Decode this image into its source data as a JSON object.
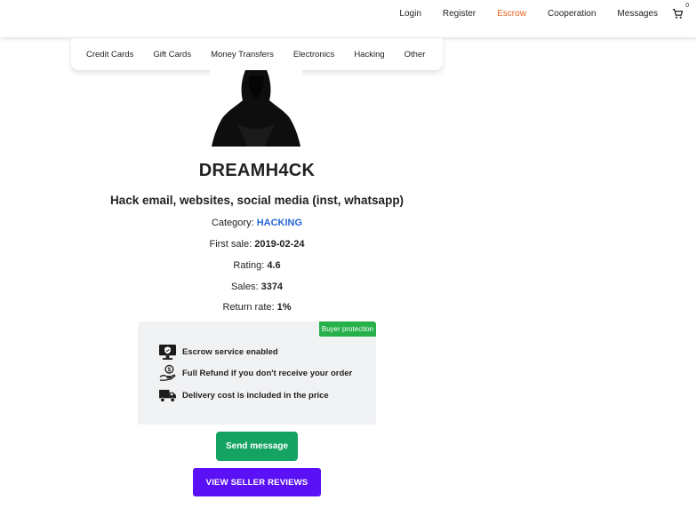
{
  "topnav": {
    "items": [
      {
        "label": "Login",
        "active": false
      },
      {
        "label": "Register",
        "active": false
      },
      {
        "label": "Escrow",
        "active": true
      },
      {
        "label": "Cooperation",
        "active": false
      },
      {
        "label": "Messages",
        "active": false
      }
    ],
    "cart_icon": "shopping-cart-icon",
    "cart_count": "0",
    "active_color": "#e8611a"
  },
  "categories": [
    "Credit Cards",
    "Gift Cards",
    "Money Transfers",
    "Electronics",
    "Hacking",
    "Other"
  ],
  "seller": {
    "avatar_icon": "hooded-figure-avatar",
    "name": "DREAMH4CK"
  },
  "product": {
    "title": "Hack email, websites, social media (inst, whatsapp)",
    "category_label": "Category:",
    "category_value": "HACKING",
    "first_sale_label": "First sale:",
    "first_sale_value": "2019-02-24",
    "rating_label": "Rating:",
    "rating_value": "4.6",
    "sales_label": "Sales:",
    "sales_value": "3374",
    "return_rate_label": "Return rate:",
    "return_rate_value": "1%",
    "link_color": "#2867d6"
  },
  "protection": {
    "badge": "Buyer protection",
    "badge_color": "#25b04a",
    "items": [
      {
        "icon": "shield-monitor-icon",
        "text": "Escrow service enabled"
      },
      {
        "icon": "refund-hand-icon",
        "text": "Full Refund if you don't receive your order"
      },
      {
        "icon": "delivery-truck-icon",
        "text": "Delivery cost is included in the price"
      }
    ]
  },
  "actions": {
    "send_message": "Send message",
    "send_color": "#14a363",
    "view_reviews": "VIEW SELLER REVIEWS",
    "reviews_color": "#5b11f5"
  }
}
